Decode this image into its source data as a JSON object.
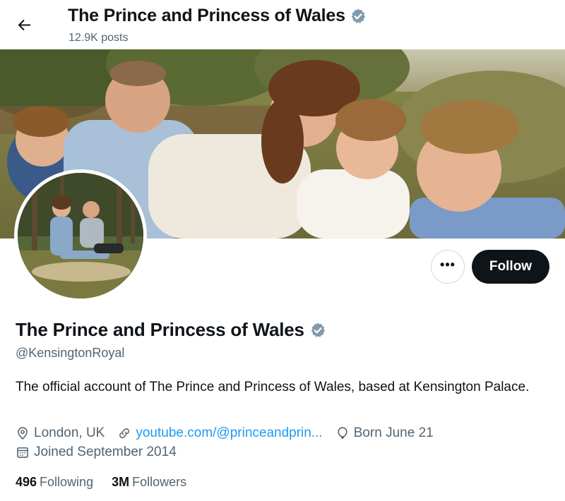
{
  "header": {
    "title": "The Prince and Princess of Wales",
    "posts": "12.9K posts"
  },
  "profile": {
    "name": "The Prince and Princess of Wales",
    "handle": "@KensingtonRoyal",
    "bio": "The official account of The Prince and Princess of Wales, based at Kensington Palace.",
    "location": "London, UK",
    "website": "youtube.com/@princeandprin...",
    "birthday": "Born June 21",
    "joined": "Joined September 2014",
    "following_count": "496",
    "following_label": "Following",
    "followers_count": "3M",
    "followers_label": "Followers",
    "verified": true
  },
  "actions": {
    "more": "•••",
    "follow": "Follow"
  },
  "icons": {
    "back": "arrow-left-icon",
    "verified": "verified-badge-icon",
    "location": "location-pin-icon",
    "link": "link-icon",
    "birthday": "balloon-icon",
    "joined": "calendar-icon"
  },
  "colors": {
    "text": "#0f1419",
    "secondary": "#536471",
    "link": "#1d9bf0",
    "verified": "#829aab",
    "follow_bg": "#0f1419"
  }
}
